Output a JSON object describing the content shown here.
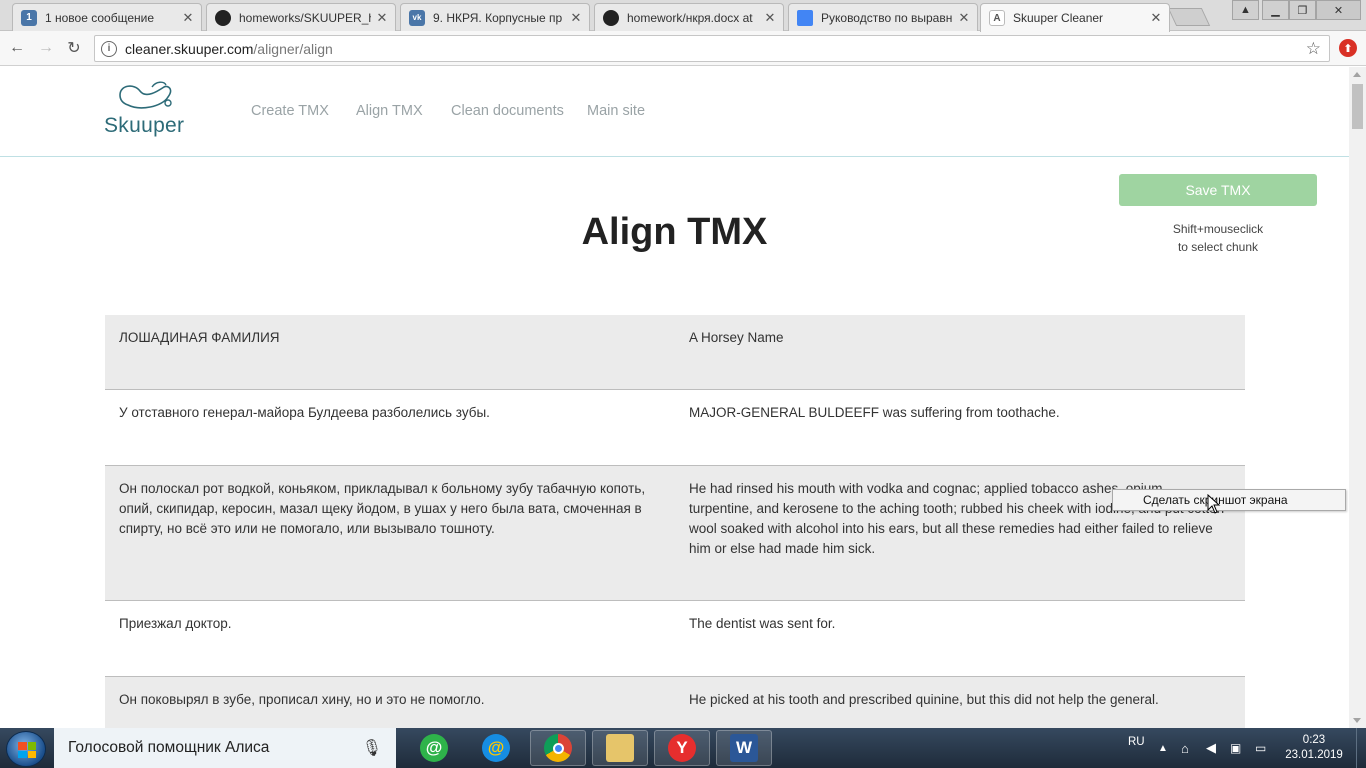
{
  "browser": {
    "tabs": [
      {
        "title": "1 новое сообщение",
        "icon": "vk-mail-icon",
        "favicon_label": "1",
        "color": "#4a76a8",
        "active": false
      },
      {
        "title": "homeworks/SKUUPER_hc",
        "icon": "github-icon",
        "favicon_label": "",
        "color": "#222222",
        "active": false
      },
      {
        "title": "9. НКРЯ. Корпусные пр",
        "icon": "vk-icon",
        "favicon_label": "vk",
        "color": "#4a76a8",
        "active": false
      },
      {
        "title": "homework/нкря.docx at",
        "icon": "github-icon",
        "favicon_label": "",
        "color": "#222222",
        "active": false
      },
      {
        "title": "Руководство по выравн",
        "icon": "google-docs-icon",
        "favicon_label": "",
        "color": "#4285f4",
        "active": false
      },
      {
        "title": "Skuuper Cleaner",
        "icon": "skuuper-icon",
        "favicon_label": "A",
        "color": "#6b6b6b",
        "active": true
      }
    ],
    "url_host": "cleaner.skuuper.com",
    "url_path": "/aligner/align"
  },
  "site": {
    "logo_text": "Skuuper",
    "nav": [
      "Create TMX",
      "Align TMX",
      "Clean documents",
      "Main site"
    ],
    "save_button": "Save TMX",
    "hint_line1": "Shift+mouseclick",
    "hint_line2": "to select chunk",
    "title": "Align TMX"
  },
  "rows": [
    {
      "source": "ЛОШАДИНАЯ ФАМИЛИЯ",
      "target": "A Horsey Name"
    },
    {
      "source": "У отставного генерал-майора Булдеева разболелись зубы.",
      "target": "MAJOR-GENERAL BULDEEFF was suffering from toothache."
    },
    {
      "source": "Он полоскал рот водкой, коньяком, прикладывал к больному зубу табачную копоть, опий, скипидар, керосин, мазал щеку йодом, в ушах у него была вата, смоченная в спирту, но всё это или не помогало, или вызывало тошноту.",
      "target": "He had rinsed his mouth with vodka and cognac; applied tobacco ashes, opium, turpentine, and kerosene to the aching tooth; rubbed his cheek with iodine, and put cotton wool soaked with alcohol into his ears, but all these remedies had either failed to relieve him or else had made him sick."
    },
    {
      "source": "Приезжал доктор.",
      "target": "The dentist was sent for."
    },
    {
      "source": "Он поковырял в зубе, прописал хину, но и это не помогло.",
      "target": "He picked at his tooth and prescribed quinine, but this did not help the general."
    }
  ],
  "context_popup": "Сделать скриншот экрана",
  "taskbar": {
    "assistant_text": "Голосовой помощник Алиса",
    "lang": "RU",
    "time": "0:23",
    "date": "23.01.2019"
  },
  "colors": {
    "save_button": "#9fd4a1",
    "row_grey": "#ebebeb",
    "logo": "#2d6b78",
    "nav": "#9aa3a6"
  }
}
